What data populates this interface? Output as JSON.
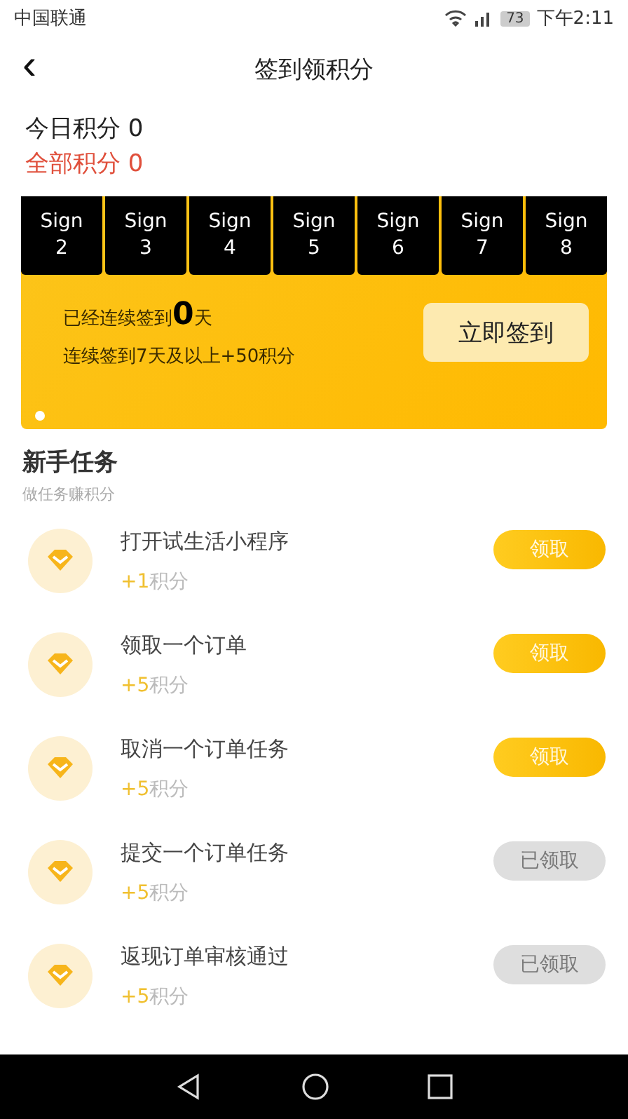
{
  "status_bar": {
    "carrier": "中国联通",
    "battery": "73",
    "time": "下午2:11"
  },
  "header": {
    "back": "‹",
    "title": "签到领积分"
  },
  "scores": {
    "today": "今日积分 0",
    "total": "全部积分 0"
  },
  "sign_days": [
    {
      "label": "Sign",
      "day": "2"
    },
    {
      "label": "Sign",
      "day": "3"
    },
    {
      "label": "Sign",
      "day": "4"
    },
    {
      "label": "Sign",
      "day": "5"
    },
    {
      "label": "Sign",
      "day": "6"
    },
    {
      "label": "Sign",
      "day": "7"
    },
    {
      "label": "Sign",
      "day": "8"
    }
  ],
  "sign_card": {
    "streak": "已经连续签到**0**天",
    "bonus": "连续签到7天及以上+50积分",
    "button": "立即签到"
  },
  "section": {
    "title": "新手任务",
    "subtitle": "做任务赚积分"
  },
  "tasks": [
    {
      "title": "打开试生活小程序",
      "points": "+1",
      "unit": "积分",
      "button": "领取",
      "claimed": false
    },
    {
      "title": "领取一个订单",
      "points": "+5",
      "unit": "积分",
      "button": "领取",
      "claimed": false
    },
    {
      "title": "取消一个订单任务",
      "points": "+5",
      "unit": "积分",
      "button": "领取",
      "claimed": false
    },
    {
      "title": "提交一个订单任务",
      "points": "+5",
      "unit": "积分",
      "button": "已领取",
      "claimed": true
    },
    {
      "title": "返现订单审核通过",
      "points": "+5",
      "unit": "积分",
      "button": "已领取",
      "claimed": true
    }
  ]
}
